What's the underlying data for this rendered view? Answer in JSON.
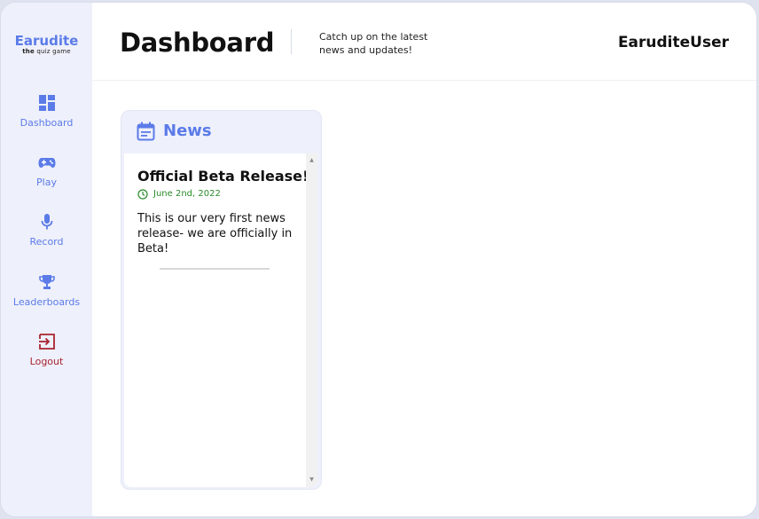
{
  "sidebar": {
    "brand": {
      "name": "Earudite",
      "tag_strong": "the",
      "tag_rest": " quiz game"
    },
    "items": [
      {
        "label": "Dashboard",
        "icon": "dashboard-icon"
      },
      {
        "label": "Play",
        "icon": "gamepad-icon"
      },
      {
        "label": "Record",
        "icon": "microphone-icon"
      },
      {
        "label": "Leaderboards",
        "icon": "trophy-icon"
      },
      {
        "label": "Logout",
        "icon": "logout-icon"
      }
    ]
  },
  "header": {
    "title": "Dashboard",
    "subtitle": "Catch up on the latest news and updates!",
    "username": "EaruditeUser"
  },
  "news": {
    "title": "News",
    "articles": [
      {
        "title": "Official Beta Release!",
        "date": "June 2nd, 2022",
        "body": "This is our very first news release- we are officially in Beta!"
      }
    ]
  },
  "colors": {
    "accent": "#5b7be8",
    "sidebar_bg": "#eef0fb",
    "logout": "#a9252f",
    "date": "#2a8c2a"
  }
}
